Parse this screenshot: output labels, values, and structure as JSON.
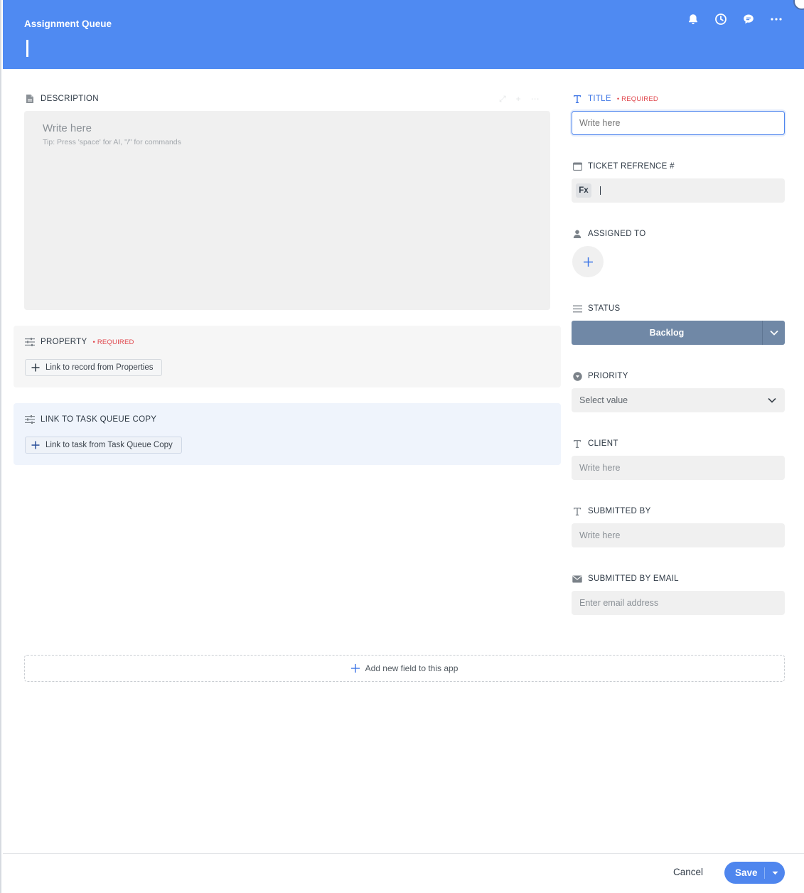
{
  "header": {
    "title": "Assignment Queue",
    "icons": [
      "bell-icon",
      "clock-icon",
      "comment-icon",
      "more-icon",
      "close-icon"
    ]
  },
  "description": {
    "label": "DESCRIPTION",
    "placeholder": "Write here",
    "tip": "Tip: Press 'space' for AI, \"/\" for commands"
  },
  "property": {
    "label": "PROPERTY",
    "required": "• REQUIRED",
    "button": "Link to record from Properties"
  },
  "task_queue": {
    "label": "LINK TO TASK QUEUE COPY",
    "button": "Link to task from Task Queue Copy"
  },
  "fields": {
    "title": {
      "label": "TITLE",
      "required": "• REQUIRED",
      "placeholder": "Write here"
    },
    "ticket": {
      "label": "TICKET REFRENCE #",
      "badge": "Fx"
    },
    "assigned": {
      "label": "ASSIGNED TO"
    },
    "status": {
      "label": "STATUS",
      "value": "Backlog"
    },
    "priority": {
      "label": "PRIORITY",
      "placeholder": "Select value"
    },
    "client": {
      "label": "CLIENT",
      "placeholder": "Write here"
    },
    "submitted_by": {
      "label": "SUBMITTED BY",
      "placeholder": "Write here"
    },
    "submitted_email": {
      "label": "SUBMITTED BY EMAIL",
      "placeholder": "Enter email address"
    }
  },
  "add_field": "Add new field to this app",
  "footer": {
    "cancel": "Cancel",
    "save": "Save"
  },
  "colors": {
    "header": "#4f8af2",
    "accent": "#4f86ee",
    "required": "#e0464c",
    "status": "#7088a6"
  }
}
